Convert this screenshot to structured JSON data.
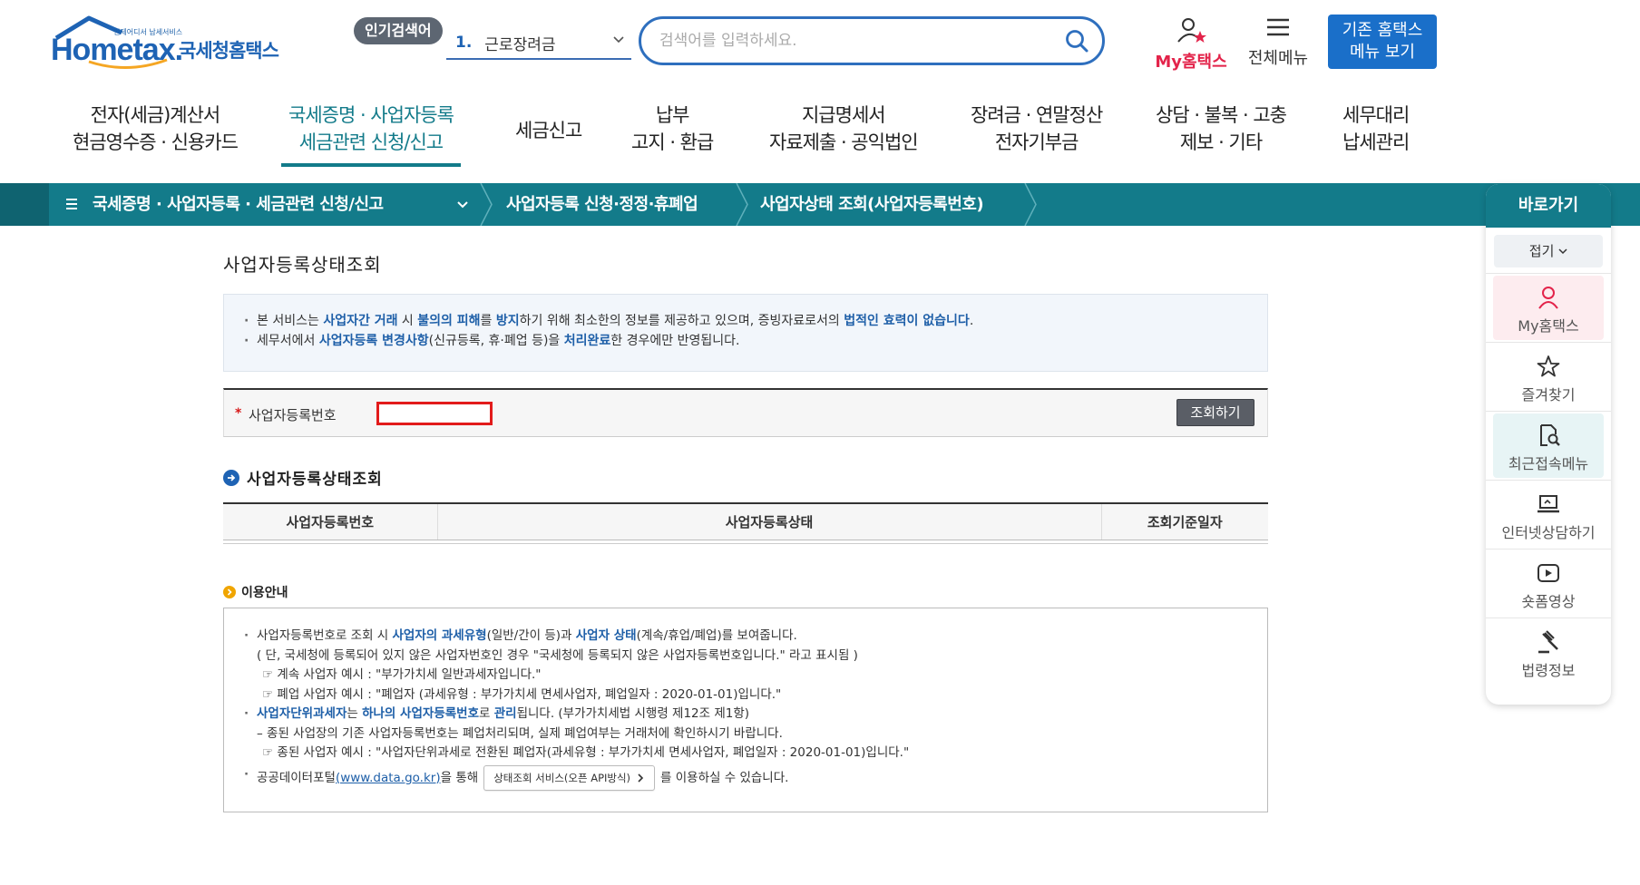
{
  "header": {
    "logo_tagline": "언제어디서 납세서비스",
    "logo_text": "Hometax.",
    "logo_korean": "국세청홈택스",
    "popular_badge": "인기검색어",
    "popular_rank": "1.",
    "popular_term": "근로장려금",
    "search_placeholder": "검색어를 입력하세요.",
    "my_hometax": "My홈택스",
    "all_menu": "전체메뉴",
    "legacy_line1": "기존 홈택스",
    "legacy_line2": "메뉴 보기"
  },
  "main_nav": [
    {
      "line1": "전자(세금)계산서",
      "line2": "현금영수증 · 신용카드",
      "active": false
    },
    {
      "line1": "국세증명 · 사업자등록",
      "line2": "세금관련 신청/신고",
      "active": true
    },
    {
      "line1": "세금신고",
      "line2": "",
      "active": false
    },
    {
      "line1": "납부",
      "line2": "고지 · 환급",
      "active": false
    },
    {
      "line1": "지급명세서",
      "line2": "자료제출 · 공익법인",
      "active": false
    },
    {
      "line1": "장려금 · 연말정산",
      "line2": "전자기부금",
      "active": false
    },
    {
      "line1": "상담 · 불복 · 고충",
      "line2": "제보 · 기타",
      "active": false
    },
    {
      "line1": "세무대리",
      "line2": "납세관리",
      "active": false
    }
  ],
  "breadcrumb": [
    "국세증명 · 사업자등록 · 세금관련 신청/신고",
    "사업자등록 신청·정정·휴폐업",
    "사업자상태 조회(사업자등록번호)"
  ],
  "quick": {
    "title": "바로가기",
    "fold": "접기",
    "items": [
      "My홈택스",
      "즐겨찾기",
      "최근접속메뉴",
      "인터넷상담하기",
      "숏폼영상",
      "법령정보"
    ]
  },
  "content": {
    "page_title": "사업자등록상태조회",
    "notice": {
      "l1_a": "본 서비스는 ",
      "l1_b": "사업자간 거래",
      "l1_c": " 시 ",
      "l1_d": "불의의 피해",
      "l1_e": "를 ",
      "l1_f": "방지",
      "l1_g": "하기 위해 최소한의 정보를 제공하고 있으며, 증빙자료로서의 ",
      "l1_h": "법적인 효력이 없습니다",
      "l1_i": ".",
      "l2_a": "세무서에서 ",
      "l2_b": "사업자등록 변경사항",
      "l2_c": "(신규등록, 휴·폐업 등)을 ",
      "l2_d": "처리완료",
      "l2_e": "한 경우에만 반영됩니다."
    },
    "query": {
      "required_mark": "*",
      "label": "사업자등록번호",
      "input_value": "",
      "button": "조회하기"
    },
    "section_title": "사업자등록상태조회",
    "table_headers": [
      "사업자등록번호",
      "사업자등록상태",
      "조회기준일자"
    ],
    "guide_title": "이용안내",
    "guide": {
      "r1_a": "사업자등록번호로 조회 시 ",
      "r1_b": "사업자의 과세유형",
      "r1_c": "(일반/간이 등)과 ",
      "r1_d": "사업자 상태",
      "r1_e": "(계속/휴업/폐업)를 보여줍니다.",
      "r2": "( 단, 국세청에 등록되어 있지 않은 사업자번호인 경우 \"국세청에 등록되지 않은 사업자등록번호입니다.\" 라고 표시됨 )",
      "r3": "☞ 계속 사업자 예시 : \"부가가치세 일반과세자입니다.\"",
      "r4": "☞ 폐업 사업자 예시 : \"폐업자 (과세유형 : 부가가치세 면세사업자, 폐업일자 : 2020-01-01)입니다.\"",
      "r5_a": "사업자단위과세자",
      "r5_b": "는 ",
      "r5_c": "하나의 사업자등록번호",
      "r5_d": "로 ",
      "r5_e": "관리",
      "r5_f": "됩니다. (부가가치세법 시행령 제12조 제1항)",
      "r6": "– 종된 사업장의 기존 사업자등록번호는 폐업처리되며, 실제 폐업여부는 거래처에 확인하시기 바랍니다.",
      "r7": "☞ 종된 사업자 예시 : \"사업자단위과세로 전환된 폐업자(과세유형 : 부가가치세 면세사업자, 폐업일자 : 2020-01-01)입니다.\"",
      "r8_a": "공공데이터포털",
      "r8_link": "(www.data.go.kr)",
      "r8_b": "을 통해",
      "r8_btn": "상태조회 서비스(오픈 API방식)",
      "r8_c": "를 이용하실 수 있습니다."
    }
  },
  "colors": {
    "teal": "#137b8a",
    "brand_blue": "#1e63b4",
    "required_red": "#d71a1a",
    "my_pink": "#e3234a"
  }
}
